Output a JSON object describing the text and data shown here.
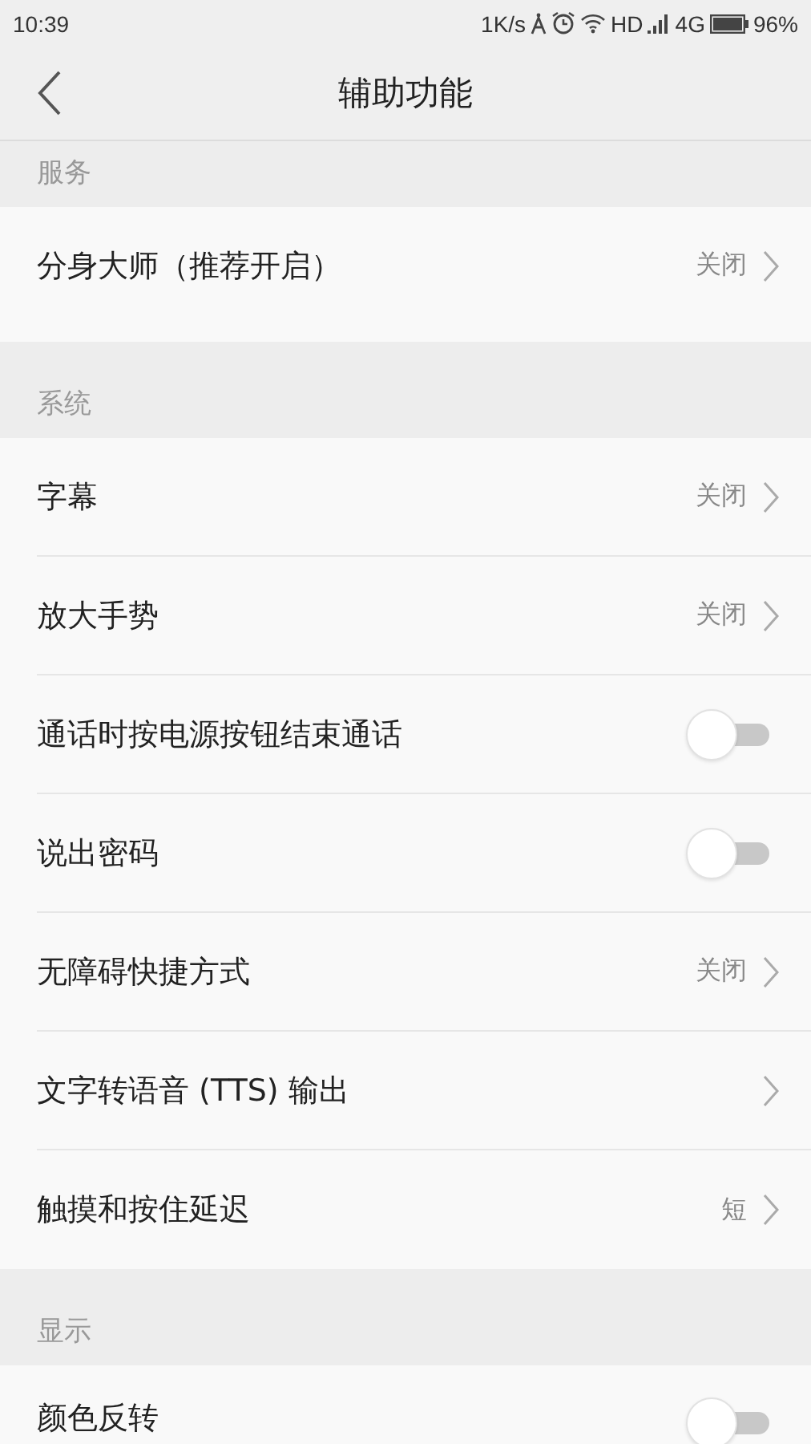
{
  "status_bar": {
    "time": "10:39",
    "speed": "1K/s",
    "hd": "HD",
    "network": "4G",
    "battery": "96%"
  },
  "app_bar": {
    "title": "辅助功能"
  },
  "sections": [
    {
      "title": "服务",
      "rows": [
        {
          "kind": "link",
          "label": "分身大师（推荐开启）",
          "value": "关闭"
        }
      ]
    },
    {
      "title": "系统",
      "rows": [
        {
          "kind": "link",
          "label": "字幕",
          "value": "关闭"
        },
        {
          "kind": "link",
          "label": "放大手势",
          "value": "关闭"
        },
        {
          "kind": "toggle",
          "label": "通话时按电源按钮结束通话",
          "on": false
        },
        {
          "kind": "toggle",
          "label": "说出密码",
          "on": false
        },
        {
          "kind": "link",
          "label": "无障碍快捷方式",
          "value": "关闭"
        },
        {
          "kind": "link",
          "label": "文字转语音 (TTS) 输出"
        },
        {
          "kind": "link",
          "label": "触摸和按住延迟",
          "value": "短"
        }
      ]
    },
    {
      "title": "显示",
      "rows": [
        {
          "kind": "toggle",
          "label": "颜色反转",
          "on": false
        }
      ]
    }
  ]
}
